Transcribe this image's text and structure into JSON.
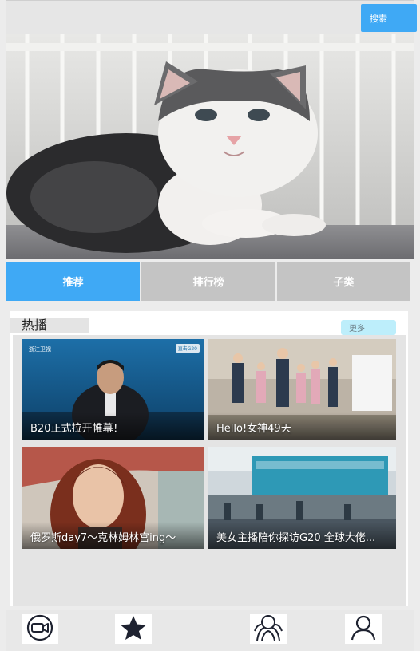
{
  "header": {
    "search_label": "搜索"
  },
  "tabs": [
    {
      "label": "推荐",
      "active": true
    },
    {
      "label": "排行榜",
      "active": false
    },
    {
      "label": "子类",
      "active": false
    }
  ],
  "hot": {
    "title": "热播",
    "more_label": "更多",
    "cards": [
      {
        "caption": "B20正式拉开帷幕！",
        "badge": "直击G20"
      },
      {
        "caption": "Hello!女神49天"
      },
      {
        "caption": "俄罗斯day7～克林姆林宫ing～"
      },
      {
        "caption": "美女主播陪你探访G20 全球大佬..."
      }
    ]
  },
  "bottom_nav": [
    {
      "icon": "video-camera-icon"
    },
    {
      "icon": "star-icon"
    },
    {
      "icon": "group-icon"
    },
    {
      "icon": "user-icon"
    }
  ],
  "colors": {
    "accent": "#3fa9f5",
    "tab_inactive": "#c4c4c4",
    "more_bg": "#bdeefb"
  }
}
